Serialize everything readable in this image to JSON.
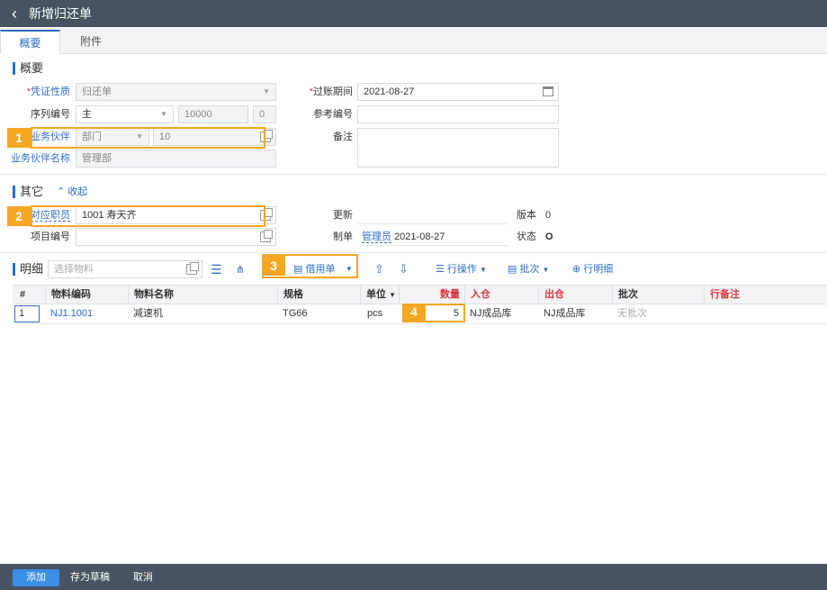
{
  "header": {
    "title": "新增归还单",
    "back_icon": "chevron-left-icon"
  },
  "tabs": [
    {
      "label": "概要"
    },
    {
      "label": "附件"
    }
  ],
  "summary": {
    "title": "概要",
    "voucher_type": {
      "label": "凭证性质",
      "value": "归还单"
    },
    "posting_period": {
      "label": "过账期间",
      "value": "2021-08-27"
    },
    "serial": {
      "label": "序列编号",
      "value": "主",
      "number": "10000",
      "suffix": "0"
    },
    "reference_no": {
      "label": "参考编号",
      "value": ""
    },
    "partner": {
      "label": "业务伙伴",
      "type": "部门",
      "code": "10"
    },
    "remark": {
      "label": "备注",
      "value": ""
    },
    "partner_name": {
      "label": "业务伙伴名称",
      "value": "管理部"
    }
  },
  "other": {
    "title": "其它",
    "collapse_label": "收起",
    "staff": {
      "label": "对应职员",
      "value": "1001 寿天齐"
    },
    "update": {
      "label": "更新",
      "value": ""
    },
    "version": {
      "label": "版本",
      "value": "0"
    },
    "project": {
      "label": "项目编号",
      "value": ""
    },
    "creator": {
      "label": "制单",
      "user": "管理员",
      "date": "2021-08-27"
    },
    "status": {
      "label": "状态",
      "value": "O"
    }
  },
  "detail": {
    "title": "明细",
    "search_placeholder": "选择物料",
    "borrow_button": "借用单",
    "row_ops": "行操作",
    "batch": "批次",
    "row_detail": "行明细"
  },
  "grid": {
    "headers": {
      "index": "#",
      "code": "物料编码",
      "name": "物料名称",
      "spec": "规格",
      "unit": "单位",
      "qty": "数量",
      "in_wh": "入仓",
      "out_wh": "出仓",
      "batch": "批次",
      "note": "行备注"
    },
    "rows": [
      {
        "index": "1",
        "code": "NJ1.1001",
        "name": "减速机",
        "spec": "TG66",
        "unit": "pcs",
        "qty": "5",
        "in_wh": "NJ成品库",
        "out_wh": "NJ成品库",
        "batch": "无批次",
        "note": ""
      }
    ]
  },
  "badges": [
    "1",
    "2",
    "3",
    "4"
  ],
  "footer": {
    "add": "添加",
    "draft": "存为草稿",
    "cancel": "取消"
  },
  "colors": {
    "accent": "#2e6cc8",
    "highlight": "#f5a623",
    "header_bg": "#475360",
    "required": "#d9363e"
  }
}
